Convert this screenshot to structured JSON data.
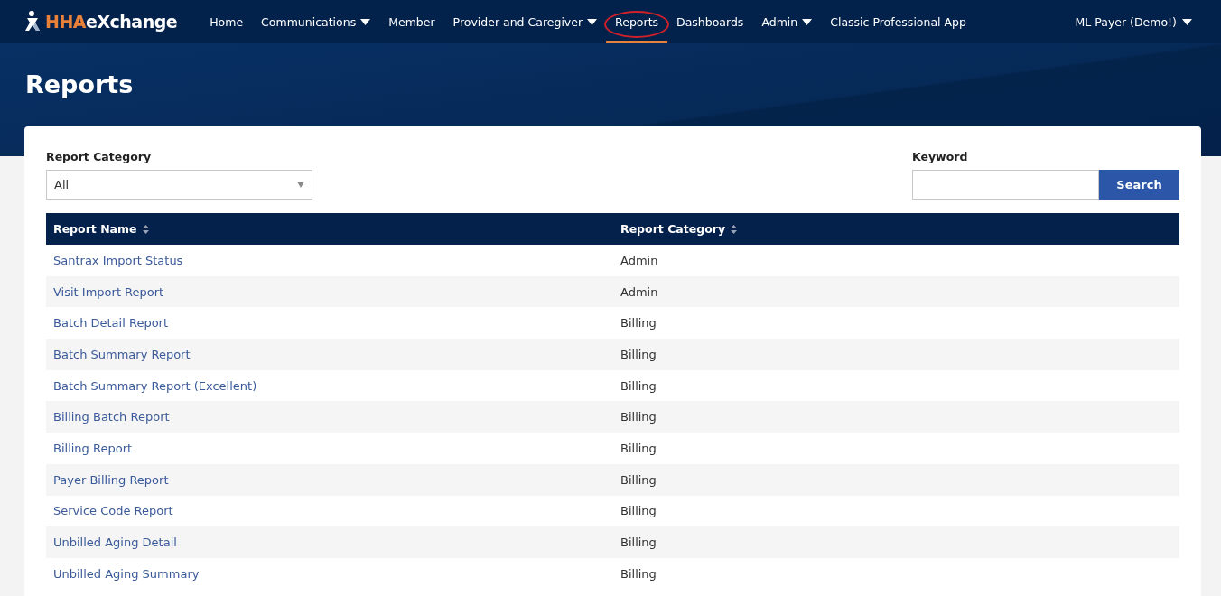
{
  "logo": {
    "part_1": "HHA",
    "part_2": "eXchange"
  },
  "nav": [
    {
      "label": "Home",
      "dropdown": false,
      "selected": false,
      "circled": false
    },
    {
      "label": "Communications",
      "dropdown": true,
      "selected": false,
      "circled": false
    },
    {
      "label": "Member",
      "dropdown": false,
      "selected": false,
      "circled": false
    },
    {
      "label": "Provider and Caregiver",
      "dropdown": true,
      "selected": false,
      "circled": false
    },
    {
      "label": "Reports",
      "dropdown": false,
      "selected": true,
      "circled": true
    },
    {
      "label": "Dashboards",
      "dropdown": false,
      "selected": false,
      "circled": false
    },
    {
      "label": "Admin",
      "dropdown": true,
      "selected": false,
      "circled": false
    },
    {
      "label": "Classic Professional App",
      "dropdown": false,
      "selected": false,
      "circled": false
    }
  ],
  "user_menu": {
    "label": "ML Payer (Demo!)"
  },
  "page_title": "Reports",
  "filters": {
    "category_label": "Report Category",
    "category_value": "All",
    "keyword_label": "Keyword",
    "search_button": "Search"
  },
  "table": {
    "columns": [
      "Report Name",
      "Report Category"
    ],
    "rows": [
      {
        "name": "Santrax Import Status",
        "category": "Admin"
      },
      {
        "name": "Visit Import Report",
        "category": "Admin"
      },
      {
        "name": "Batch Detail Report",
        "category": "Billing"
      },
      {
        "name": "Batch Summary Report",
        "category": "Billing"
      },
      {
        "name": "Batch Summary Report (Excellent)",
        "category": "Billing"
      },
      {
        "name": "Billing Batch Report",
        "category": "Billing"
      },
      {
        "name": "Billing Report",
        "category": "Billing"
      },
      {
        "name": "Payer Billing Report",
        "category": "Billing"
      },
      {
        "name": "Service Code Report",
        "category": "Billing"
      },
      {
        "name": "Unbilled Aging Detail",
        "category": "Billing"
      },
      {
        "name": "Unbilled Aging Summary",
        "category": "Billing"
      }
    ]
  }
}
